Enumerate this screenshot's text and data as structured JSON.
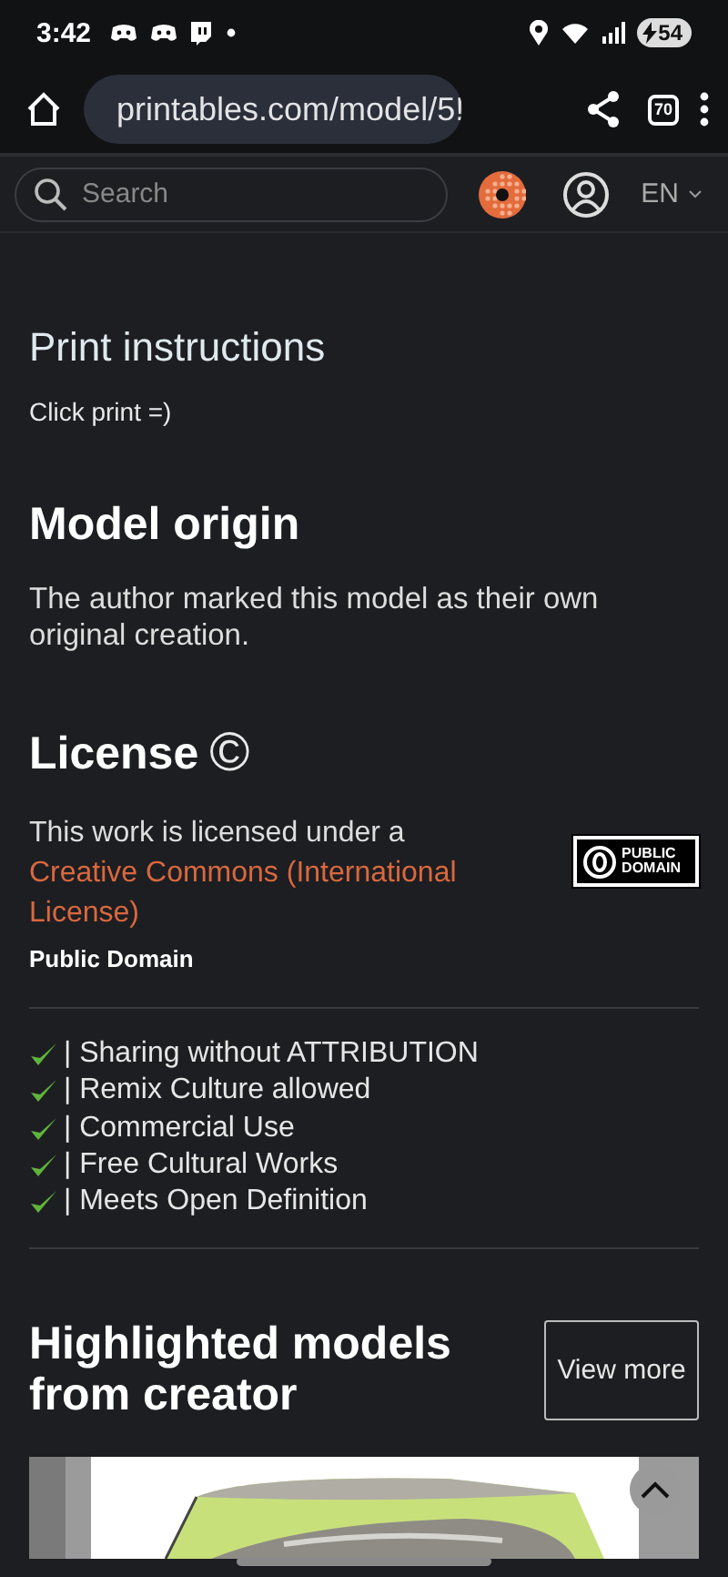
{
  "status_bar": {
    "time": "3:42",
    "battery": "54"
  },
  "browser": {
    "url": "printables.com/model/5!",
    "tab_count": "70"
  },
  "header": {
    "search": {
      "placeholder": "Search"
    },
    "language": "EN"
  },
  "sections": [
    {
      "kind": "subheading",
      "title": "Print instructions",
      "text": "Click print =)"
    },
    {
      "kind": "heading",
      "title": "Model origin",
      "text": "The author marked this model as their own original creation."
    }
  ],
  "license": {
    "title": "License",
    "icon": "©",
    "text": "This work is licensed under a",
    "link": "Creative Commons (International License)",
    "name": "Public Domain",
    "badge": [
      "PUBLIC",
      "DOMAIN"
    ],
    "rights": [
      {
        "label": "| Sharing without ATTRIBUTION",
        "checked": true
      },
      {
        "label": "| Remix Culture allowed",
        "checked": true
      },
      {
        "label": "| Commercial Use",
        "checked": true
      },
      {
        "label": "| Free Cultural Works",
        "checked": true
      },
      {
        "label": "| Meets Open Definition",
        "checked": true
      }
    ]
  },
  "highlighted": {
    "title": "Highlighted models from creator",
    "button": "View more"
  }
}
